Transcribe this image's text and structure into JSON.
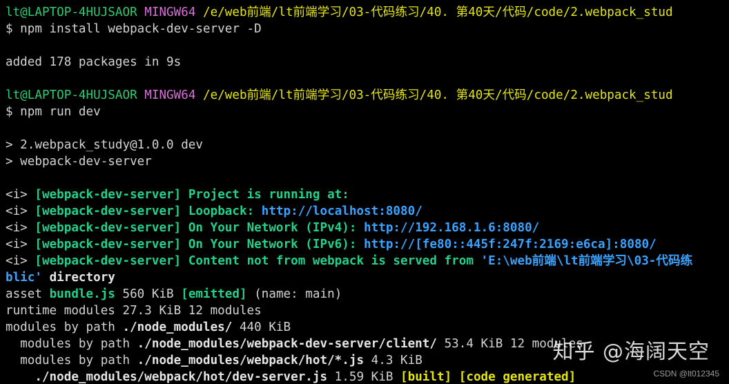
{
  "terminal": {
    "prompt1": {
      "user": "lt@LAPTOP-4HUJSAOR",
      "shell": "MINGW64",
      "path": "/e/web前端/lt前端学习/03-代码练习/40. 第40天/代码/code/2.webpack_stud"
    },
    "cmd1": "$ npm install webpack-dev-server -D",
    "added": "added 178 packages in 9s",
    "prompt2": {
      "user": "lt@LAPTOP-4HUJSAOR",
      "shell": "MINGW64",
      "path": "/e/web前端/lt前端学习/03-代码练习/40. 第40天/代码/code/2.webpack_stud"
    },
    "cmd2": "$ npm run dev",
    "script1": "> 2.webpack_study@1.0.0 dev",
    "script2": "> webpack-dev-server",
    "info_prefix": "<i>",
    "info_tag": "[webpack-dev-server]",
    "info1": "Project is running at:",
    "info2_label": "Loopback:",
    "info2_url": "http://localhost:8080/",
    "info3_label": "On Your Network (IPv4):",
    "info3_url": "http://192.168.1.6:8080/",
    "info4_label": "On Your Network (IPv6):",
    "info4_url": "http://[fe80::445f:247f:2169:e6ca]:8080/",
    "info5_label": "Content not from webpack is served from",
    "info5_path": "'E:\\web前端\\lt前端学习\\03-代码练",
    "wrap_blic": "blic'",
    "wrap_directory": "directory",
    "asset_word": "asset",
    "asset_file": "bundle.js",
    "asset_size": "560 KiB",
    "asset_emitted": "[emitted]",
    "asset_name": "(name: main)",
    "runtime_line": "runtime modules 27.3 KiB 12 modules",
    "mbp_prefix": "modules by path",
    "mbp1_path": "./node_modules/",
    "mbp1_size": "440 KiB",
    "mbp2_path": "./node_modules/webpack-dev-server/client/",
    "mbp2_size": "53.4 KiB 12 modules",
    "mbp3_path": "./node_modules/webpack/hot/*.js",
    "mbp3_size": "4.3 KiB",
    "dev_path": "./node_modules/webpack/hot/dev-server.js",
    "dev_size": "1.59 KiB",
    "dev_built": "[built]",
    "dev_generated": "[code generated]"
  },
  "watermark": "知乎 @海阔天空",
  "credit": "CSDN @lt012345",
  "colors": {
    "background": "#000000",
    "prompt_user": "#2ecc71",
    "prompt_shell": "#d670d6",
    "prompt_path": "#e5e510",
    "info_green": "#23d18b",
    "url_blue": "#3ba3ff"
  }
}
